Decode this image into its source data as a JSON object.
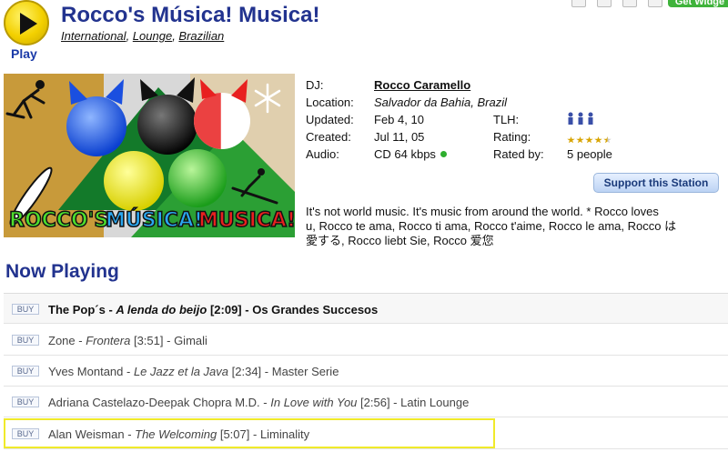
{
  "header": {
    "play_label": "Play",
    "station_name": "Rocco's Música! Musica!",
    "genres": [
      "International",
      "Lounge",
      "Brazilian"
    ],
    "widget_label": "Get Widge"
  },
  "artwork": {
    "logo_words": [
      "ROCCO'S",
      "MÚSICA!",
      "MUSICA!"
    ]
  },
  "info": {
    "dj_label": "DJ:",
    "dj_name": "Rocco Caramello",
    "location_label": "Location:",
    "location": "Salvador da Bahia, Brazil",
    "updated_label": "Updated:",
    "updated": "Feb 4, 10",
    "tlh_label": "TLH:",
    "created_label": "Created:",
    "created": "Jul 11, 05",
    "rating_label": "Rating:",
    "rating_stars": 4.5,
    "audio_label": "Audio:",
    "audio": "CD 64 kbps",
    "rated_by_label": "Rated by:",
    "rated_by": "5 people"
  },
  "support_button": "Support this Station",
  "description": [
    "It's not world music. It's music from around the world. * Rocco loves",
    "u, Rocco te ama, Rocco ti ama, Rocco t'aime, Rocco le ama, Rocco は",
    "愛する, Rocco liebt Sie, Rocco 爱您"
  ],
  "now_playing": {
    "heading": "Now Playing",
    "buy_label": "BUY",
    "tracks": [
      {
        "artist": "The Pop´s",
        "title": "A lenda do beijo",
        "duration": "[2:09]",
        "album": "Os Grandes Succesos"
      },
      {
        "artist": "Zone",
        "title": "Frontera",
        "duration": "[3:51]",
        "album": "Gimali"
      },
      {
        "artist": "Yves Montand",
        "title": "Le Jazz et la Java",
        "duration": "[2:34]",
        "album": "Master Serie"
      },
      {
        "artist": "Adriana Castelazo-Deepak Chopra M.D.",
        "title": "In Love with You",
        "duration": "[2:56]",
        "album": "Latin Lounge"
      },
      {
        "artist": "Alan Weisman",
        "title": "The Welcoming",
        "duration": "[5:07]",
        "album": "Liminality"
      }
    ],
    "separator": " - "
  },
  "colors": {
    "title_blue": "#22338f",
    "play_yellow": "#f3d000",
    "highlight_yellow": "#f0ea2a",
    "star_gold": "#d8a400",
    "status_green": "#2eae2e"
  }
}
